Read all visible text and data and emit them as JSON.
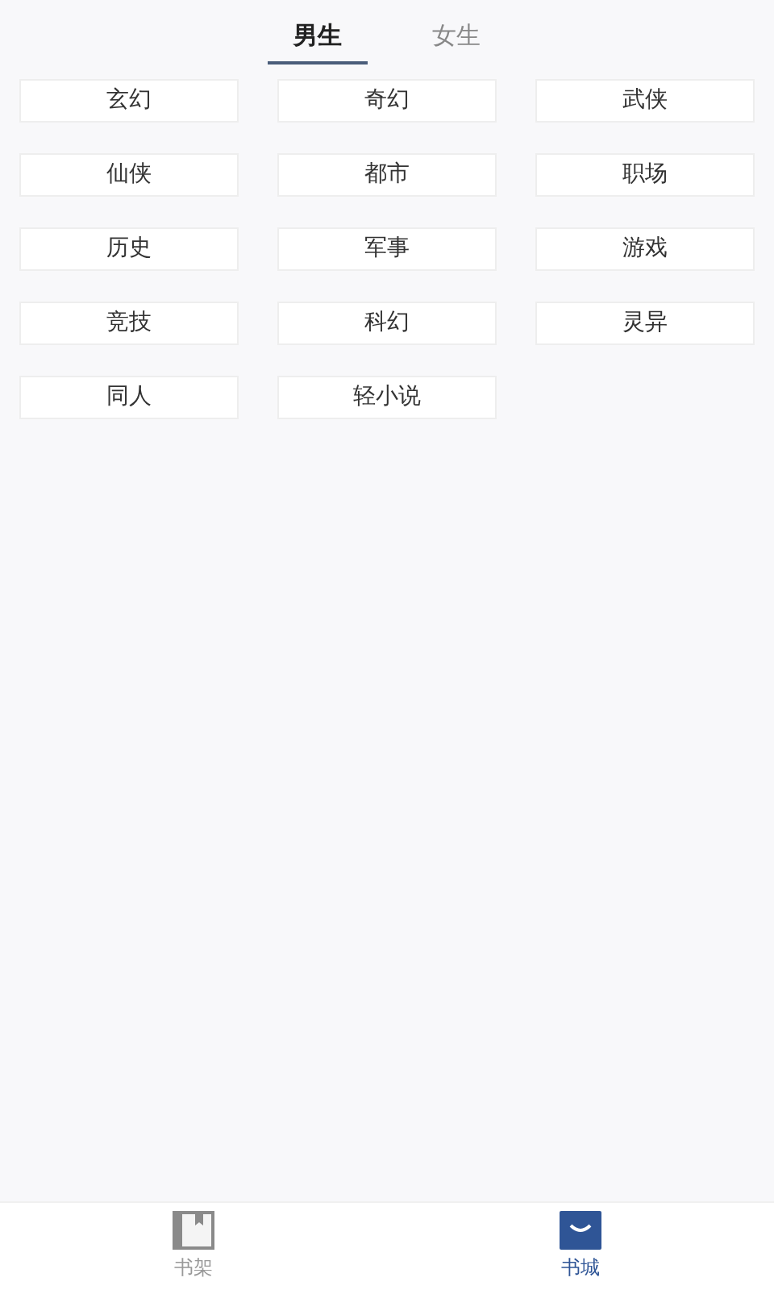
{
  "tabs": [
    {
      "label": "男生",
      "selected": true
    },
    {
      "label": "女生",
      "selected": false
    }
  ],
  "categories": [
    "玄幻",
    "奇幻",
    "武侠",
    "仙侠",
    "都市",
    "职场",
    "历史",
    "军事",
    "游戏",
    "竞技",
    "科幻",
    "灵异",
    "同人",
    "轻小说"
  ],
  "bottom_nav": [
    {
      "label": "书架",
      "kind": "shelf",
      "selected": false
    },
    {
      "label": "书城",
      "kind": "store",
      "selected": true
    }
  ]
}
